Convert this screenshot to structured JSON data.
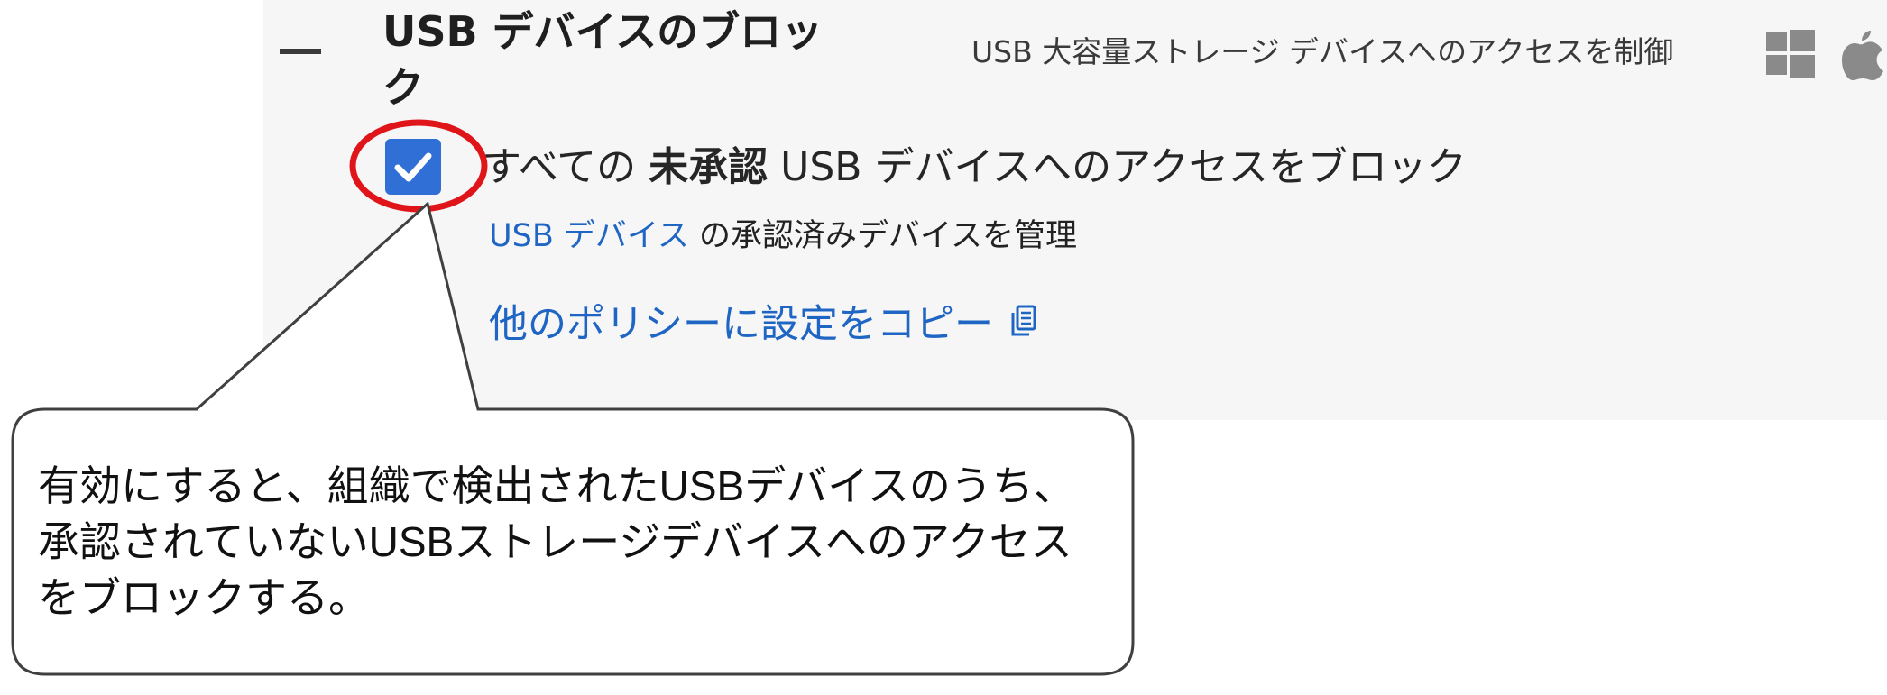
{
  "section": {
    "title": "USB デバイスのブロック",
    "description": "USB 大容量ストレージ デバイスへのアクセスを制御",
    "icons": [
      "windows-icon",
      "apple-icon"
    ]
  },
  "setting": {
    "checked": true,
    "label_prefix": "すべての ",
    "label_bold": "未承認",
    "label_suffix": " USB デバイスへのアクセスをブロック",
    "manage_link": "USB デバイス",
    "manage_suffix": " の承認済みデバイスを管理",
    "copy_link": "他のポリシーに設定をコピー",
    "copy_icon": "copy-icon"
  },
  "callout": {
    "lines": [
      "有効にすると、組織で検出されたUSBデバイスのうち、",
      "承認されていないUSBストレージデバイスへのアクセス",
      "をブロックする。"
    ]
  },
  "colors": {
    "accent": "#2f6fd6",
    "link": "#1f65c4",
    "highlight": "#e0151a",
    "panel_bg": "#f6f6f6"
  }
}
